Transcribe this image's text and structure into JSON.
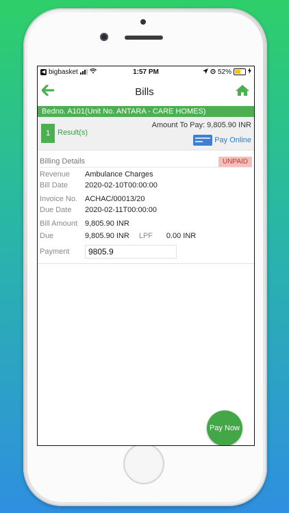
{
  "status_bar": {
    "app": "bigbasket",
    "time": "1:57 PM",
    "battery": "52%"
  },
  "header": {
    "title": "Bills",
    "back_icon": "arrow-left-icon",
    "home_icon": "home-icon",
    "accent": "#4caf50"
  },
  "banner": {
    "bed_text": "Bedno. A101(Unit No. ANTARA - CARE HOMES)"
  },
  "results": {
    "count": "1",
    "label": "Result(s)",
    "amount_to_pay": "Amount To Pay: 9,805.90 INR",
    "pay_online": "Pay Online"
  },
  "billing": {
    "heading": "Billing Details",
    "status": "UNPAID",
    "revenue_label": "Revenue",
    "revenue_value": "Ambulance Charges",
    "bill_date_label": "Bill Date",
    "bill_date_value": "2020-02-10T00:00:00",
    "invoice_label": "Invoice No.",
    "invoice_value": "ACHAC/00013/20",
    "due_date_label": "Due Date",
    "due_date_value": "2020-02-11T00:00:00",
    "bill_amount_label": "Bill Amount",
    "bill_amount_value": "9,805.90 INR",
    "due_label": "Due",
    "due_value": "9,805.90 INR",
    "lpf_label": "LPF",
    "lpf_value": "0.00 INR",
    "payment_label": "Payment",
    "payment_value": "9805.9"
  },
  "actions": {
    "pay_now": "Pay Now"
  }
}
